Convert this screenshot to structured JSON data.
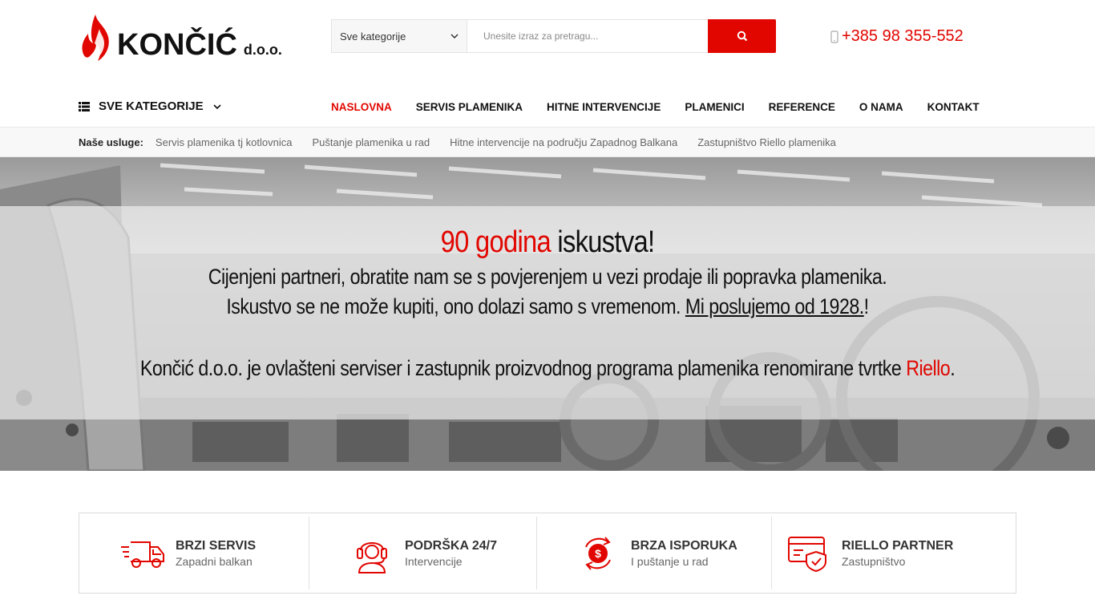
{
  "brand": {
    "name": "KONČIĆ",
    "suffix": "d.o.o."
  },
  "search": {
    "category": "Sve kategorije",
    "placeholder": "Unesite izraz za pretragu..."
  },
  "phone": "+385 98 355-552",
  "nav": {
    "all_categories": "SVE KATEGORIJE",
    "items": [
      "NASLOVNA",
      "SERVIS PLAMENIKA",
      "HITNE INTERVENCIJE",
      "PLAMENICI",
      "REFERENCE",
      "O NAMA",
      "KONTAKT"
    ],
    "active": "NASLOVNA"
  },
  "services_bar": {
    "label": "Naše usluge:",
    "items": [
      "Servis plamenika tj kotlovnica",
      "Puštanje plamenika u rad",
      "Hitne intervencije na području Zapadnog Balkana",
      "Zastupništvo Riello plamenika"
    ]
  },
  "hero": {
    "title_red": "90 godina",
    "title_rest": "iskustva!",
    "line1": "Cijenjeni partneri, obratite nam se s povjerenjem u vezi prodaje ili popravka plamenika.",
    "line2_a": "Iskustvo se ne može kupiti, ono dolazi samo s vremenom.",
    "line2_link": "Mi poslujemo od 1928.",
    "line2_end": "!",
    "line3_a": "Končić d.o.o. je ovlašteni serviser i zastupnik proizvodnog programa plamenika renomirane tvrtke",
    "line3_red": "Riello",
    "line3_end": "."
  },
  "features": [
    {
      "title": "BRZI SERVIS",
      "subtitle": "Zapadni balkan",
      "icon": "truck-icon"
    },
    {
      "title": "PODRŠKA 24/7",
      "subtitle": "Intervencije",
      "icon": "headset-icon"
    },
    {
      "title": "BRZA ISPORUKA",
      "subtitle": "I puštanje u rad",
      "icon": "dollar-refresh-icon"
    },
    {
      "title": "RIELLO PARTNER",
      "subtitle": "Zastupništvo",
      "icon": "card-shield-icon"
    }
  ],
  "colors": {
    "accent": "#e10600",
    "text": "#111111"
  }
}
